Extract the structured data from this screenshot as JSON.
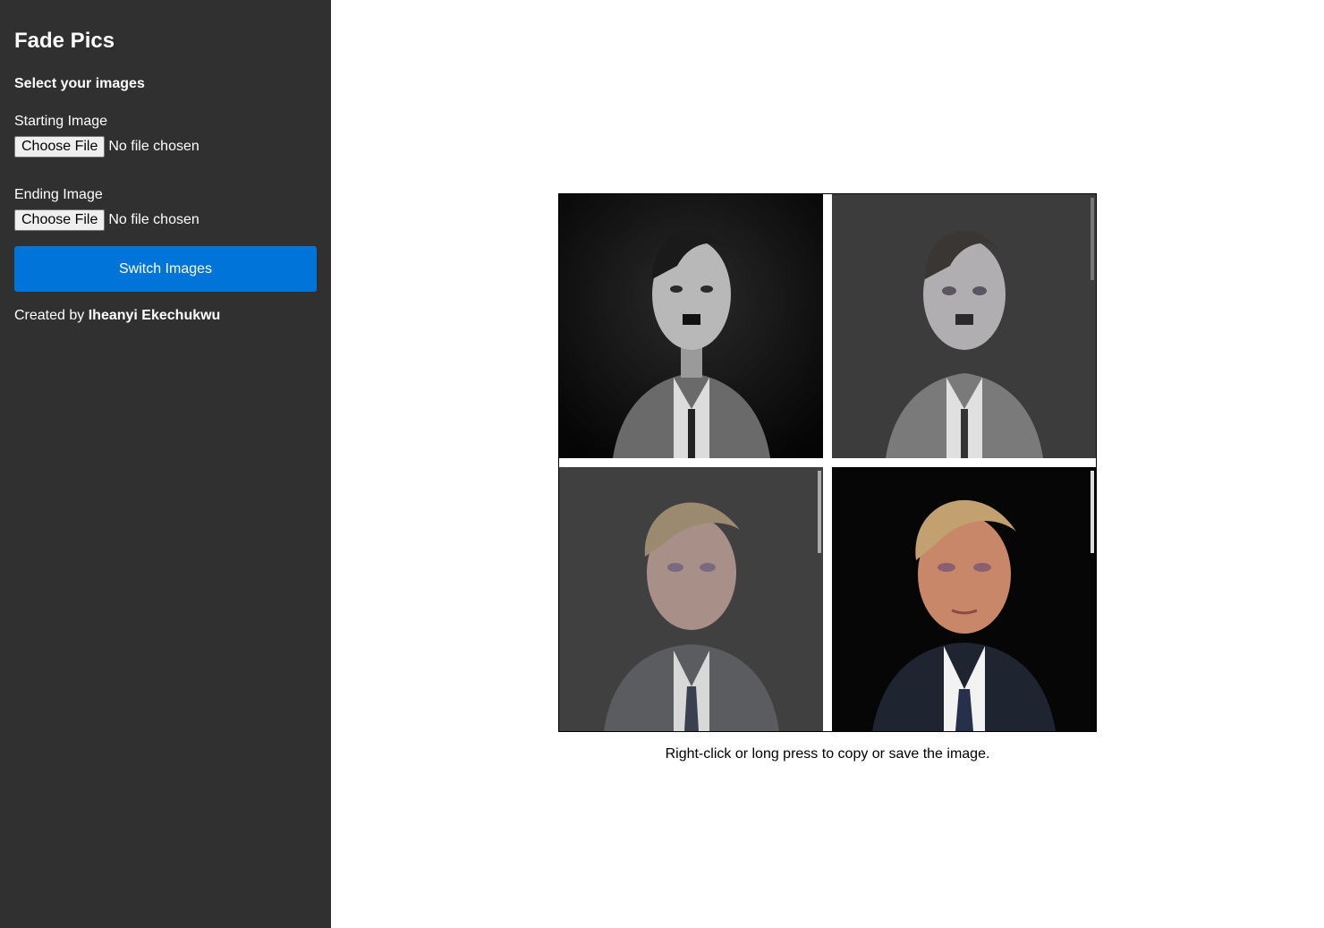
{
  "sidebar": {
    "title": "Fade Pics",
    "section_title": "Select your images",
    "starting_image": {
      "label": "Starting Image",
      "button_label": "Choose File",
      "status": "No file chosen"
    },
    "ending_image": {
      "label": "Ending Image",
      "button_label": "Choose File",
      "status": "No file chosen"
    },
    "switch_button_label": "Switch Images",
    "credit_prefix": "Created by",
    "credit_name": "Iheanyi Ekechukwu"
  },
  "main": {
    "caption": "Right-click or long press to copy or save the image."
  },
  "colors": {
    "sidebar_bg": "#303030",
    "accent": "#0074d9"
  }
}
